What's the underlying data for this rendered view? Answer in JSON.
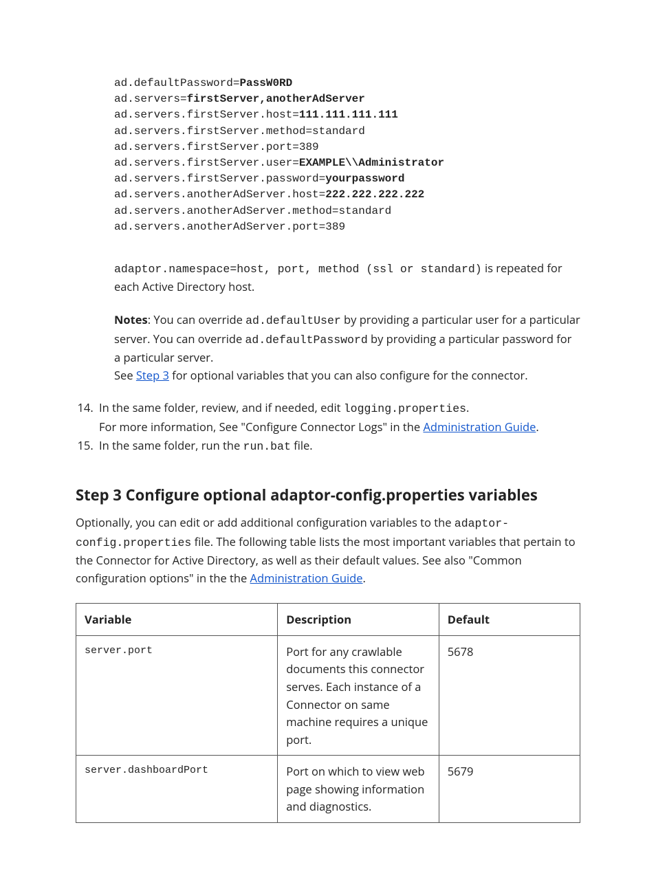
{
  "code_block": {
    "lines": [
      {
        "pre": "ad.defaultPassword=",
        "bold": "PassW0RD",
        "post": ""
      },
      {
        "pre": "ad.servers=",
        "bold": "firstServer,anotherAdServer",
        "post": ""
      },
      {
        "pre": "ad.servers.firstServer.host=",
        "bold": "111.111.111.111",
        "post": ""
      },
      {
        "pre": "ad.servers.firstServer.method=standard",
        "bold": "",
        "post": ""
      },
      {
        "pre": "ad.servers.firstServer.port=389",
        "bold": "",
        "post": ""
      },
      {
        "pre": "ad.servers.firstServer.user=",
        "bold": "EXAMPLE\\\\Administrator",
        "post": ""
      },
      {
        "pre": "ad.servers.firstServer.password=",
        "bold": "yourpassword",
        "post": ""
      },
      {
        "pre": "ad.servers.anotherAdServer.host=",
        "bold": "222.222.222.222",
        "post": ""
      },
      {
        "pre": "ad.servers.anotherAdServer.method=standard",
        "bold": "",
        "post": ""
      },
      {
        "pre": "ad.servers.anotherAdServer.port=389",
        "bold": "",
        "post": ""
      }
    ]
  },
  "para1": {
    "code": "adaptor.namespace=host, port, method (ssl or standard)",
    "tail": " is repeated for each Active Directory host."
  },
  "notes": {
    "label": "Notes",
    "t1": ": You can override ",
    "c1": "ad.defaultUser",
    "t2": " by providing a particular user for a particular server. You can override ",
    "c2": "ad.defaultPassword",
    "t3": " by providing a particular password for a particular server.",
    "see": "See ",
    "link": "Step 3",
    "after_link": " for optional variables that you can also configure for the connector."
  },
  "steps": {
    "start": 14,
    "s14": {
      "t1": "In the same folder, review, and if needed, edit ",
      "c1": "logging.properties",
      "t2": ".",
      "line2a": "For more information, See \"Configure Connector Logs\" in the ",
      "link": "Administration Guide",
      "line2b": "."
    },
    "s15": {
      "t1": "In the same folder, run the ",
      "c1": "run.bat",
      "t2": " file."
    }
  },
  "heading": "Step 3 Configure optional adaptor-config.properties variables",
  "body": {
    "t1": "Optionally, you can edit or add additional configuration variables to the ",
    "c1": "adaptor-config.properties",
    "t2": "  file. The following table lists the most important variables that pertain to the Connector for Active Directory, as well as their default values. See also \"Common configuration options\" in the the ",
    "link": "Administration Guide",
    "t3": "."
  },
  "table": {
    "headers": {
      "variable": "Variable",
      "description": "Description",
      "default": "Default"
    },
    "rows": [
      {
        "variable": "server.port",
        "description": "Port for any crawlable documents this connector serves. Each instance of a Connector on same machine requires a unique port.",
        "default": "5678"
      },
      {
        "variable": "server.dashboardPort",
        "description": "Port on which to view web page showing information and diagnostics.",
        "default": "5679"
      }
    ]
  }
}
